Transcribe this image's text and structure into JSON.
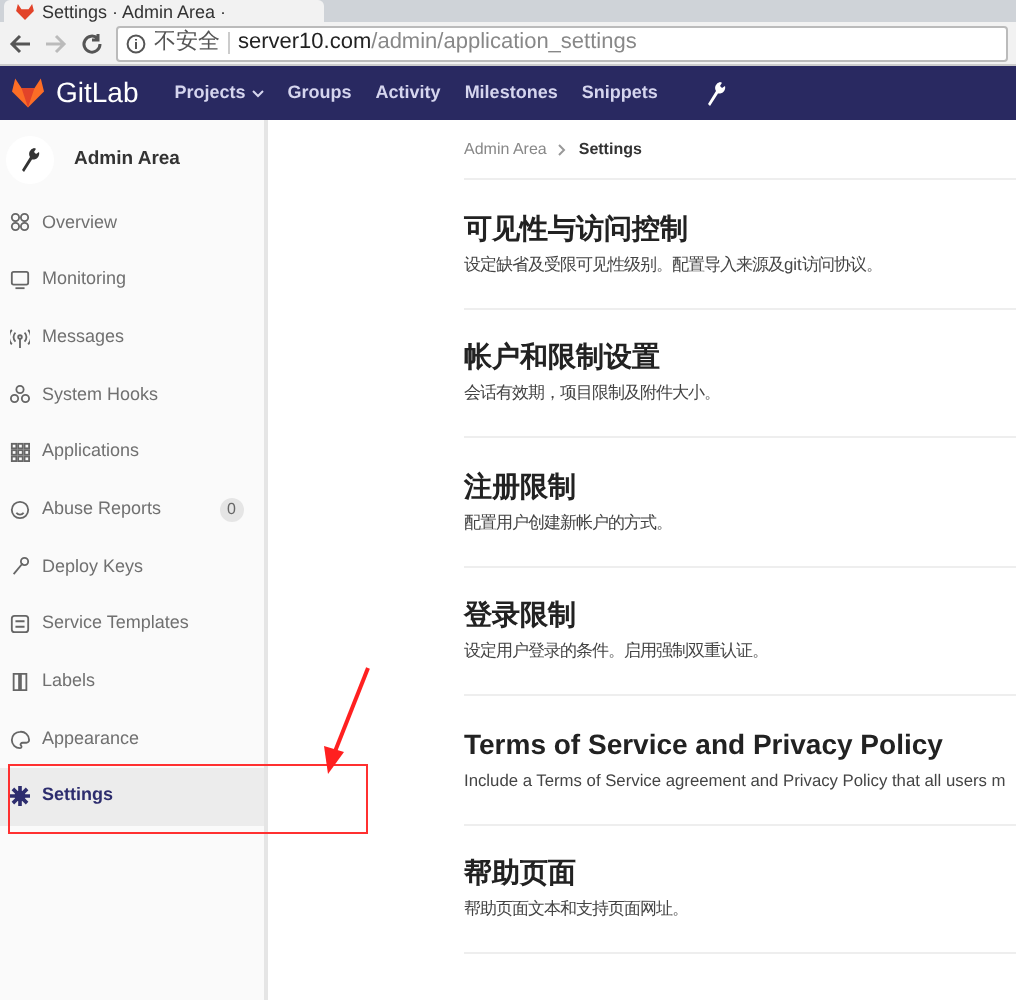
{
  "browser": {
    "tab_title": "Settings · Admin Area ·",
    "security_label": "不安全",
    "url_host": "server10.com",
    "url_path": "/admin/application_settings"
  },
  "navbar": {
    "brand": "GitLab",
    "links": [
      {
        "label": "Projects",
        "dropdown": true
      },
      {
        "label": "Groups",
        "dropdown": false
      },
      {
        "label": "Activity",
        "dropdown": false
      },
      {
        "label": "Milestones",
        "dropdown": false
      },
      {
        "label": "Snippets",
        "dropdown": false
      }
    ]
  },
  "sidebar": {
    "title": "Admin Area",
    "items": [
      {
        "label": "Overview",
        "selected": false
      },
      {
        "label": "Monitoring",
        "selected": false
      },
      {
        "label": "Messages",
        "selected": false
      },
      {
        "label": "System Hooks",
        "selected": false
      },
      {
        "label": "Applications",
        "selected": false
      },
      {
        "label": "Abuse Reports",
        "selected": false,
        "count": "0"
      },
      {
        "label": "Deploy Keys",
        "selected": false
      },
      {
        "label": "Service Templates",
        "selected": false
      },
      {
        "label": "Labels",
        "selected": false
      },
      {
        "label": "Appearance",
        "selected": false
      },
      {
        "label": "Settings",
        "selected": true
      }
    ]
  },
  "breadcrumb": [
    "Admin Area",
    "Settings"
  ],
  "sections": [
    {
      "title": "可见性与访问控制",
      "description": "设定缺省及受限可见性级别。配置导入来源及git访问协议。"
    },
    {
      "title": "帐户和限制设置",
      "description": "会话有效期，项目限制及附件大小。"
    },
    {
      "title": "注册限制",
      "description": "配置用户创建新帐户的方式。"
    },
    {
      "title": "登录限制",
      "description": "设定用户登录的条件。启用强制双重认证。"
    },
    {
      "title": "Terms of Service and Privacy Policy",
      "description": "Include a Terms of Service agreement and Privacy Policy that all users m"
    },
    {
      "title": "帮助页面",
      "description": "帮助页面文本和支持页面网址。"
    }
  ],
  "annotations": [
    {
      "kind": "box"
    },
    {
      "kind": "arrow"
    }
  ]
}
